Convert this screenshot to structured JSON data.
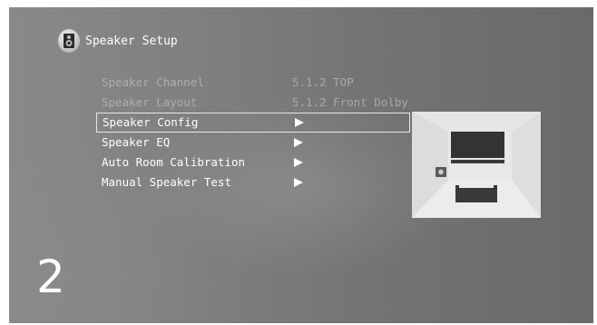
{
  "header": {
    "title": "Speaker Setup",
    "icon": "speaker-icon"
  },
  "menu": {
    "items": [
      {
        "label": "Speaker Channel",
        "value": "5.1.2 TOP",
        "state": "disabled"
      },
      {
        "label": "Speaker Layout",
        "value": "5.1.2 Front Dolby",
        "state": "disabled"
      },
      {
        "label": "Speaker Config",
        "arrow": "right-arrow-icon",
        "state": "selected"
      },
      {
        "label": "Speaker EQ",
        "arrow": "right-arrow-icon",
        "state": "enabled"
      },
      {
        "label": "Auto Room Calibration",
        "arrow": "right-arrow-icon",
        "state": "enabled"
      },
      {
        "label": "Manual Speaker Test",
        "arrow": "right-arrow-icon",
        "state": "enabled"
      }
    ]
  },
  "preview": {
    "description_icon": "room-layout-illustration-icon"
  },
  "page_number": "2",
  "colors": {
    "text": "#ffffff",
    "disabled_text": "#c8c8c8",
    "selection_border": "#e8e8e8",
    "preview_bg": "#e6e6e6",
    "preview_device": "#3a3a3a"
  }
}
